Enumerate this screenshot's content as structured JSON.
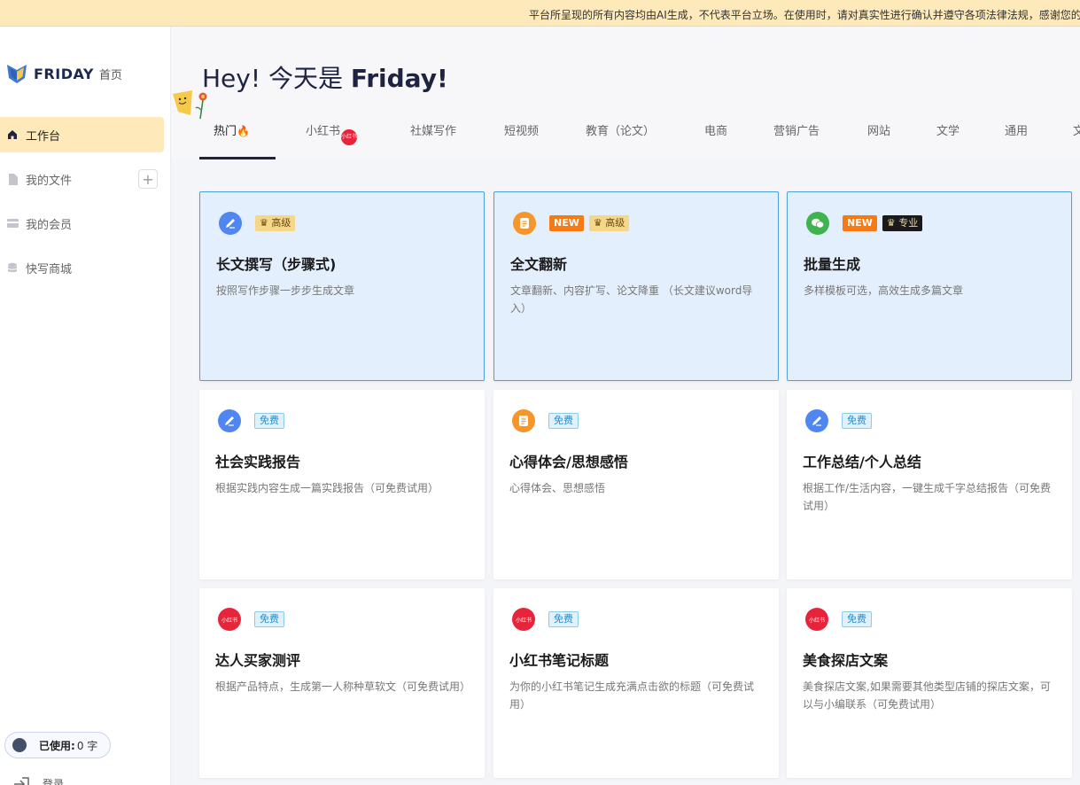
{
  "banner": {
    "text": "平台所呈现的所有内容均由AI生成，不代表平台立场。在使用时，请对真实性进行确认并遵守各项法律法规，感谢您的"
  },
  "sidebar": {
    "logo_text": "FRIDAY",
    "home_label": "首页",
    "items": [
      {
        "label": "工作台",
        "icon": "home-icon"
      },
      {
        "label": "我的文件",
        "icon": "file-icon"
      },
      {
        "label": "我的会员",
        "icon": "card-icon"
      },
      {
        "label": "快写商城",
        "icon": "coins-icon"
      }
    ],
    "add_label": "+",
    "usage_label": "已使用:",
    "usage_value": "0 字",
    "login_label": "登录"
  },
  "header": {
    "greeting_prefix": "Hey! 今天是 ",
    "greeting_day": "Friday!"
  },
  "tabs": [
    {
      "label": "热门"
    },
    {
      "label": "小红书",
      "badge": "小红书"
    },
    {
      "label": "社媒写作"
    },
    {
      "label": "短视频"
    },
    {
      "label": "教育（论文）"
    },
    {
      "label": "电商"
    },
    {
      "label": "营销广告"
    },
    {
      "label": "网站"
    },
    {
      "label": "文学"
    },
    {
      "label": "通用"
    },
    {
      "label": "文"
    }
  ],
  "badges": {
    "new": "NEW",
    "advanced": "高级",
    "pro": "专业",
    "free": "免费"
  },
  "cards": [
    {
      "title": "长文撰写（步骤式)",
      "desc": "按照写作步骤一步步生成文章",
      "icon": "pen-icon"
    },
    {
      "title": "全文翻新",
      "desc": "文章翻新、内容扩写、论文降重 （长文建议word导入）",
      "icon": "document-icon"
    },
    {
      "title": "批量生成",
      "desc": "多样模板可选，高效生成多篇文章",
      "icon": "wechat-icon"
    },
    {
      "title": "社会实践报告",
      "desc": "根据实践内容生成一篇实践报告（可免费试用）",
      "icon": "pen-icon"
    },
    {
      "title": "心得体会/思想感悟",
      "desc": "心得体会、思想感悟",
      "icon": "document-icon"
    },
    {
      "title": "工作总结/个人总结",
      "desc": "根据工作/生活内容，一键生成千字总结报告（可免费试用）",
      "icon": "pen-icon"
    },
    {
      "title": "达人买家测评",
      "desc": "根据产品特点，生成第一人称种草软文（可免费试用）",
      "icon": "xiaohongshu-icon"
    },
    {
      "title": "小红书笔记标题",
      "desc": "为你的小红书笔记生成充满点击欲的标题（可免费试用）",
      "icon": "xiaohongshu-icon"
    },
    {
      "title": "美食探店文案",
      "desc": "美食探店文案,如果需要其他类型店铺的探店文案，可以与小编联系（可免费试用）",
      "icon": "xiaohongshu-icon"
    }
  ],
  "colors": {
    "accent_yellow": "#fde9ba",
    "premium_bg": "#e3effd",
    "premium_border": "#4aa1de",
    "new_orange": "#f57a14",
    "xhs_red": "#e8243b"
  }
}
